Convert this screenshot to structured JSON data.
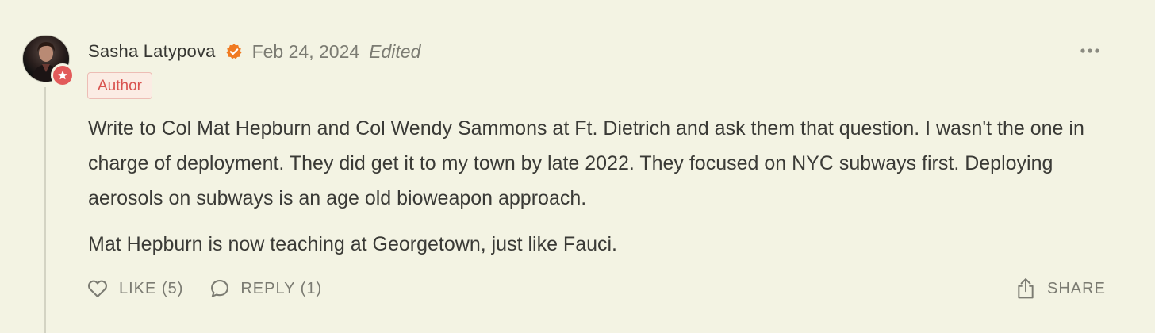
{
  "comment": {
    "author": "Sasha Latypova",
    "date": "Feb 24, 2024",
    "edited_label": "Edited",
    "badge": "Author",
    "paragraphs": [
      "Write to Col Mat Hepburn and Col Wendy Sammons at Ft. Dietrich and ask them that question. I wasn't the one in charge of deployment. They did get it to my town by late 2022. They focused on NYC subways first. Deploying aerosols on subways is an age old bioweapon approach.",
      "Mat Hepburn is now teaching at Georgetown, just like Fauci."
    ],
    "actions": {
      "like_label": "LIKE (5)",
      "reply_label": "REPLY (1)",
      "share_label": "SHARE"
    }
  },
  "icons": {
    "verified": "verified-check-icon",
    "author_star": "star-icon",
    "more": "more-dots-icon",
    "like": "heart-icon",
    "reply": "speech-bubble-icon",
    "share": "share-upload-icon"
  },
  "colors": {
    "background": "#f3f3e3",
    "accent_orange": "#f07a21",
    "author_red": "#e25a5a",
    "badge_text": "#d9534f",
    "muted_text": "#7b7b72",
    "body_text": "#3a3a36"
  }
}
